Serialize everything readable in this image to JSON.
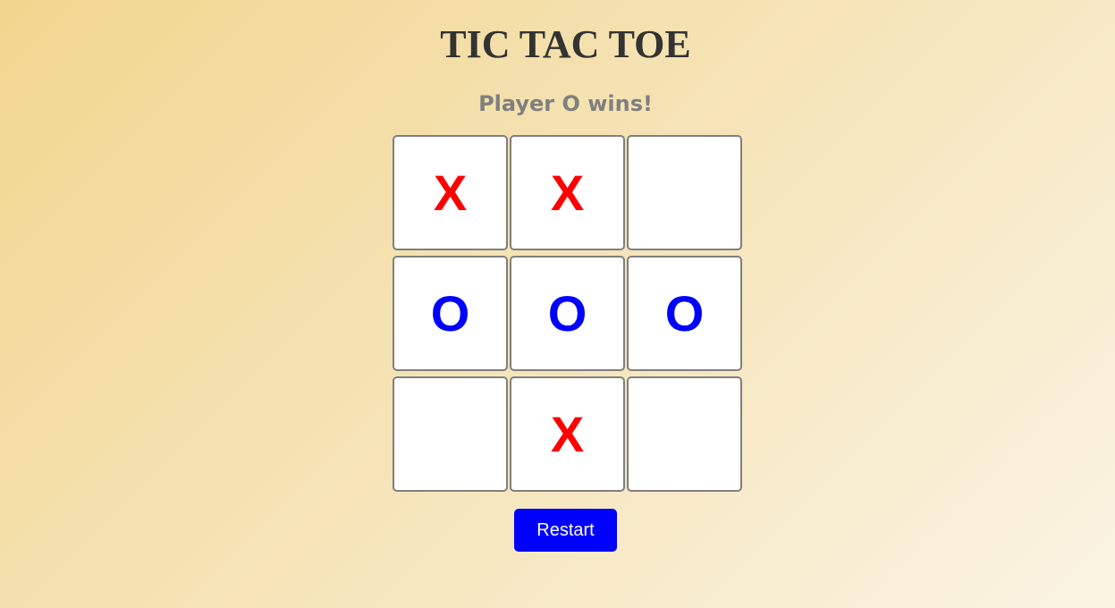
{
  "title": "TIC TAC TOE",
  "status": "Player O wins!",
  "board": {
    "cells": [
      "X",
      "X",
      "",
      "O",
      "O",
      "O",
      "",
      "X",
      ""
    ]
  },
  "restart_label": "Restart",
  "colors": {
    "x": "#ff0000",
    "o": "#0000ff",
    "button": "#0000ff",
    "title": "#333333",
    "status": "#808080"
  }
}
